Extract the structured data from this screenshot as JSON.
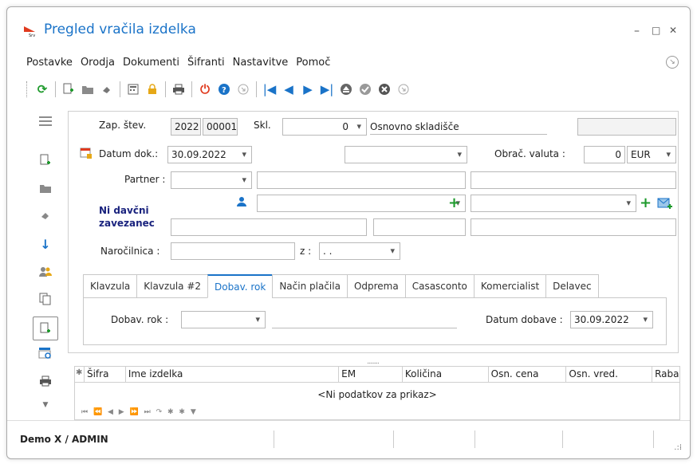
{
  "window": {
    "title": "Pregled vračila izdelka",
    "minimize": "–",
    "maximize": "□",
    "close": "✕"
  },
  "menu": [
    "Postavke",
    "Orodja",
    "Dokumenti",
    "Šifranti",
    "Nastavitve",
    "Pomoč"
  ],
  "header": {
    "zap_label": "Zap. štev.",
    "zap_year": "2022",
    "zap_num": "00001",
    "skl_label": "Skl.",
    "skl_value": "0",
    "skl_name": "Osnovno skladišče",
    "datum_label": "Datum dok.:",
    "datum_value": "30.09.2022",
    "obrac_label": "Obrač. valuta :",
    "obrac_value": "0",
    "currency": "EUR",
    "partner_label": "Partner :",
    "ndz_text": "Ni davčni zavezanec",
    "narocilnica_label": "Naročilnica :",
    "z_label": "z :",
    "z_value": ". ."
  },
  "tabs": [
    "Klavzula",
    "Klavzula #2",
    "Dobav. rok",
    "Način plačila",
    "Odprema",
    "Casasconto",
    "Komercialist",
    "Delavec"
  ],
  "active_tab": "Dobav. rok",
  "tabpanel": {
    "dobav_label": "Dobav. rok :",
    "datum_dobave_label": "Datum dobave :",
    "datum_dobave_value": "30.09.2022"
  },
  "grid": {
    "columns": [
      "Šifra",
      "Ime izdelka",
      "EM",
      "Količina",
      "Osn. cena",
      "Osn. vred.",
      "Raba"
    ],
    "empty": "<Ni podatkov za prikaz>"
  },
  "status": {
    "user": "Demo X / ADMIN"
  },
  "colors": {
    "accent": "#1a73c8",
    "green": "#1e9a2c",
    "red": "#e03a1e"
  }
}
